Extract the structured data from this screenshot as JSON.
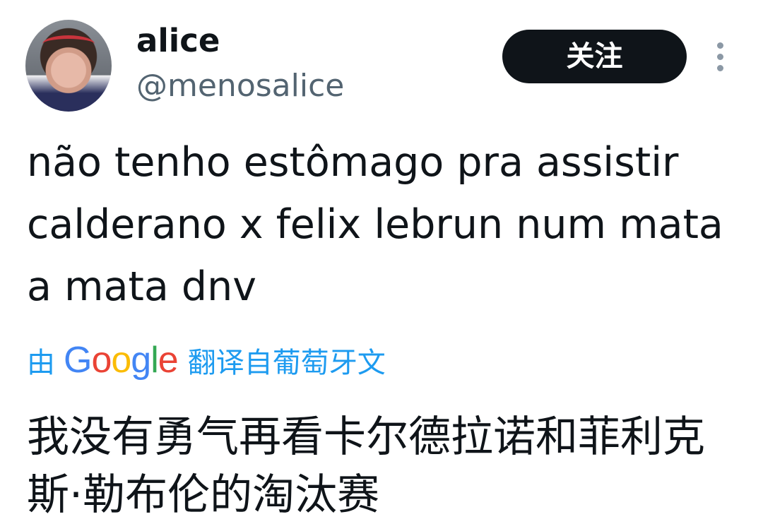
{
  "author": {
    "display_name": "alice",
    "handle": "@menosalice",
    "avatar_icon": "profile-photo"
  },
  "actions": {
    "follow_label": "关注",
    "more_icon": "more-vertical-icon"
  },
  "tweet": {
    "lines": [
      "não tenho estômago pra assistir",
      "calderano x felix lebrun num mata",
      "a mata dnv"
    ]
  },
  "translation": {
    "prefix": "由",
    "provider": "Google",
    "suffix": "翻译自葡萄牙文",
    "lines": [
      "我没有勇气再看卡尔德拉诺和菲利克",
      "斯·勒布伦的淘汰赛"
    ]
  },
  "colors": {
    "link": "#1d9bf0",
    "text": "#0f1419",
    "secondary": "#536471",
    "button_bg": "#0f1419"
  }
}
